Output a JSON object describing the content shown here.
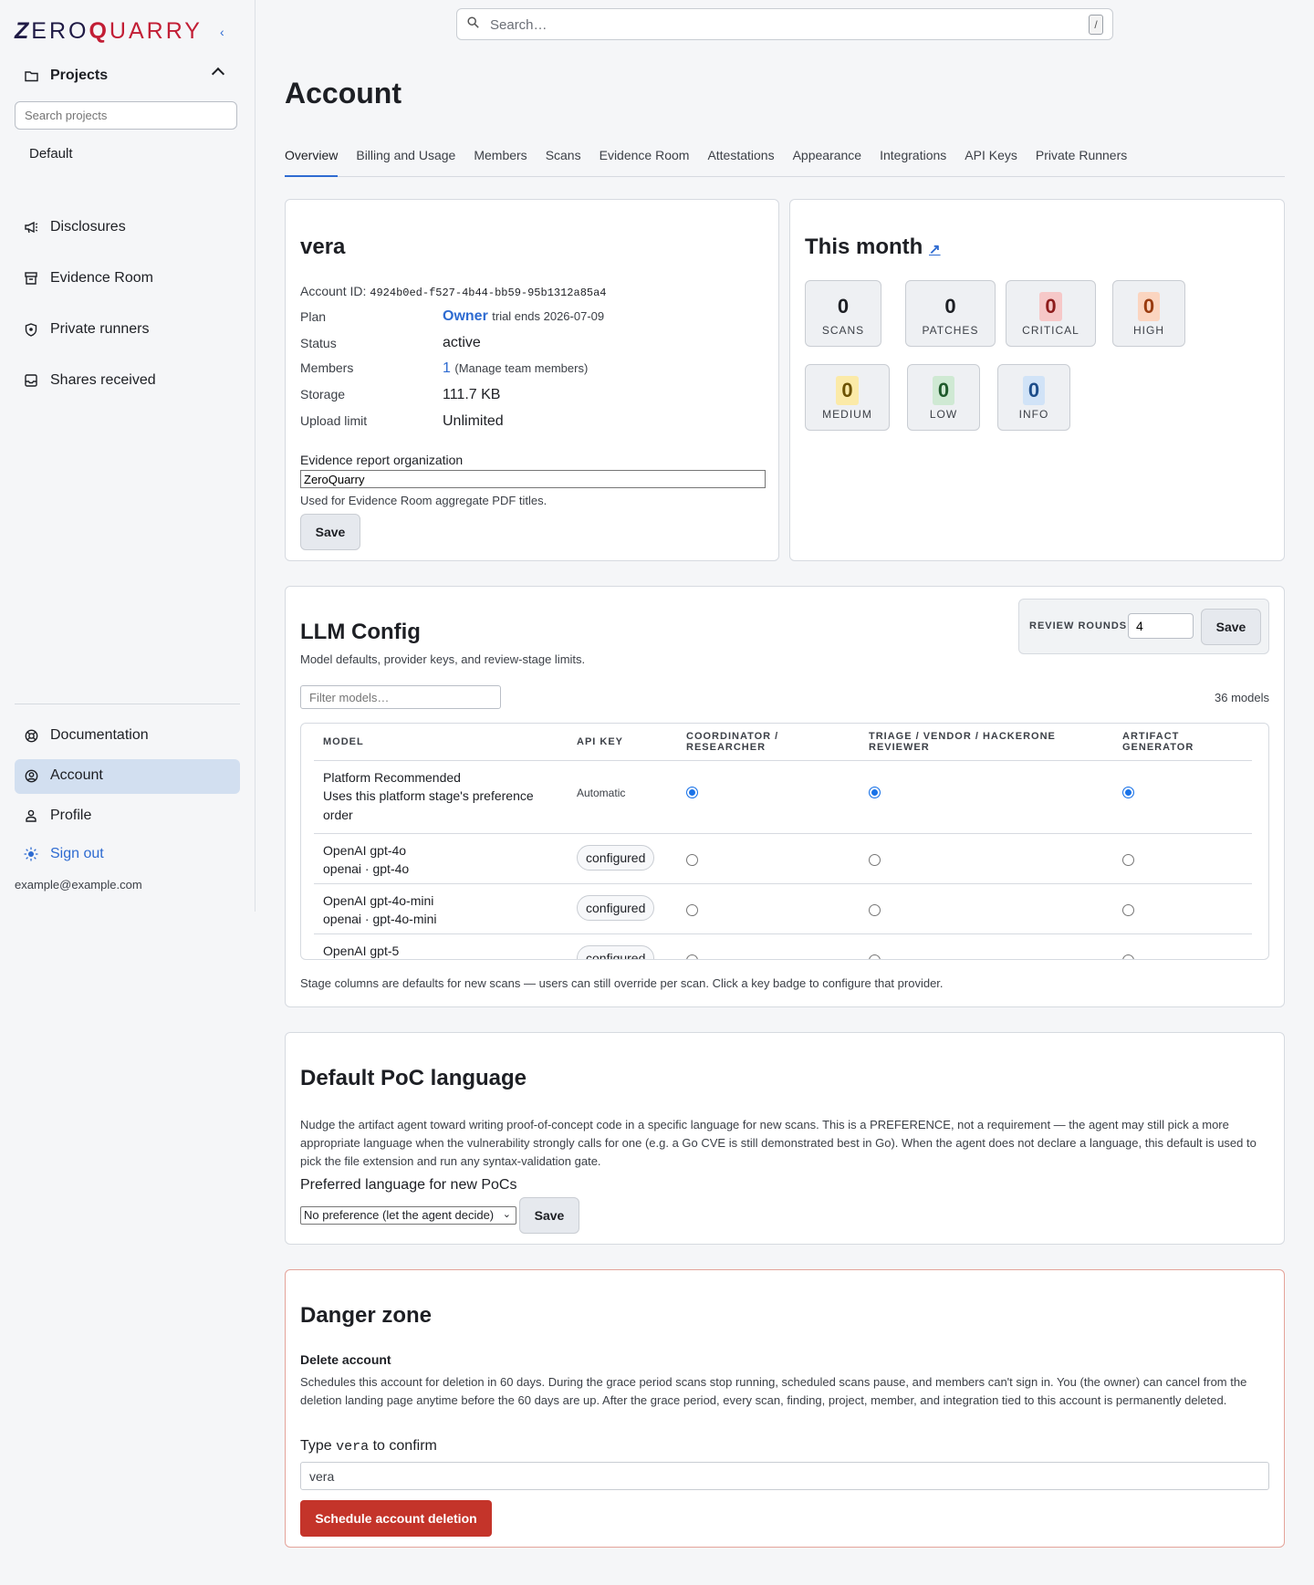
{
  "brand": {
    "logo": "ZEROQUARRY"
  },
  "sidebar": {
    "projects_label": "Projects",
    "search_placeholder": "Search projects",
    "default_project": "Default",
    "items": [
      {
        "label": "Disclosures",
        "icon": "megaphone-icon"
      },
      {
        "label": "Evidence Room",
        "icon": "archive-icon"
      },
      {
        "label": "Private runners",
        "icon": "shield-icon"
      },
      {
        "label": "Shares received",
        "icon": "inbox-icon"
      }
    ],
    "bottom": [
      {
        "label": "Documentation",
        "icon": "lifebuoy-icon"
      },
      {
        "label": "Account",
        "icon": "user-circle-icon"
      },
      {
        "label": "Profile",
        "icon": "person-icon"
      }
    ],
    "sign_out": "Sign out",
    "email": "example@example.com"
  },
  "search": {
    "placeholder": "Search…",
    "shortcut": "/"
  },
  "page": {
    "title": "Account"
  },
  "tabs": [
    "Overview",
    "Billing and Usage",
    "Members",
    "Scans",
    "Evidence Room",
    "Attestations",
    "Appearance",
    "Integrations",
    "API Keys",
    "Private Runners"
  ],
  "account": {
    "name": "vera",
    "id_label": "Account ID:",
    "id": "4924b0ed-f527-4b44-bb59-95b1312a85a4",
    "plan_label": "Plan",
    "plan": "Owner",
    "plan_note": "trial ends 2026-07-09",
    "status_label": "Status",
    "status": "active",
    "members_label": "Members",
    "members_count": "1",
    "members_link": "(Manage team members)",
    "storage_label": "Storage",
    "storage": "111.7 KB",
    "upload_label": "Upload limit",
    "upload": "Unlimited",
    "org_label": "Evidence report organization",
    "org_value": "ZeroQuarry",
    "org_help": "Used for Evidence Room aggregate PDF titles.",
    "save": "Save"
  },
  "month": {
    "title": "This month",
    "link_icon": "↗",
    "stats": [
      {
        "value": "0",
        "label": "SCANS",
        "color": "#1d1f24",
        "bg": "transparent"
      },
      {
        "value": "0",
        "label": "PATCHES",
        "color": "#1d1f24",
        "bg": "transparent"
      },
      {
        "value": "0",
        "label": "CRITICAL",
        "color": "#8e1c1c",
        "bg": "#f6c8c8"
      },
      {
        "value": "0",
        "label": "HIGH",
        "color": "#9a3b0f",
        "bg": "#fbd5c0"
      },
      {
        "value": "0",
        "label": "MEDIUM",
        "color": "#6c5200",
        "bg": "#fbeaa8"
      },
      {
        "value": "0",
        "label": "LOW",
        "color": "#1f5a2b",
        "bg": "#cfe9d3"
      },
      {
        "value": "0",
        "label": "INFO",
        "color": "#1d4d8a",
        "bg": "#d1e3f7"
      }
    ]
  },
  "llm": {
    "title": "LLM Config",
    "subtitle": "Model defaults, provider keys, and review-stage limits.",
    "review_label": "REVIEW ROUNDS",
    "review_value": "4",
    "save": "Save",
    "filter_placeholder": "Filter models…",
    "count": "36 models",
    "columns": [
      "MODEL",
      "API KEY",
      "COORDINATOR / RESEARCHER",
      "TRIAGE / VENDOR / HACKERONE REVIEWER",
      "ARTIFACT GENERATOR"
    ],
    "rows": [
      {
        "name": "Platform Recommended",
        "sub": "Uses this platform stage's preference order",
        "key": "Automatic",
        "selected": true
      },
      {
        "name": "OpenAI gpt-4o",
        "sub": "openai · gpt-4o",
        "key": "configured",
        "selected": false
      },
      {
        "name": "OpenAI gpt-4o-mini",
        "sub": "openai · gpt-4o-mini",
        "key": "configured",
        "selected": false
      },
      {
        "name": "OpenAI gpt-5",
        "sub": "",
        "key": "configured",
        "selected": false
      }
    ],
    "footnote": "Stage columns are defaults for new scans — users can still override per scan. Click a key badge to configure that provider."
  },
  "poc": {
    "title": "Default PoC language",
    "description": "Nudge the artifact agent toward writing proof-of-concept code in a specific language for new scans. This is a PREFERENCE, not a requirement — the agent may still pick a more appropriate language when the vulnerability strongly calls for one (e.g. a Go CVE is still demonstrated best in Go). When the agent does not declare a language, this default is used to pick the file extension and run any syntax-validation gate.",
    "label": "Preferred language for new PoCs",
    "selected": "No preference (let the agent decide)",
    "save": "Save"
  },
  "danger": {
    "title": "Danger zone",
    "subtitle": "Delete account",
    "description": "Schedules this account for deletion in 60 days. During the grace period scans stop running, scheduled scans pause, and members can't sign in. You (the owner) can cancel from the deletion landing page anytime before the 60 days are up. After the grace period, every scan, finding, project, member, and integration tied to this account is permanently deleted.",
    "confirm_prefix": "Type",
    "confirm_code": "vera",
    "confirm_suffix": "to confirm",
    "input_value": "vera",
    "button": "Schedule account deletion"
  }
}
